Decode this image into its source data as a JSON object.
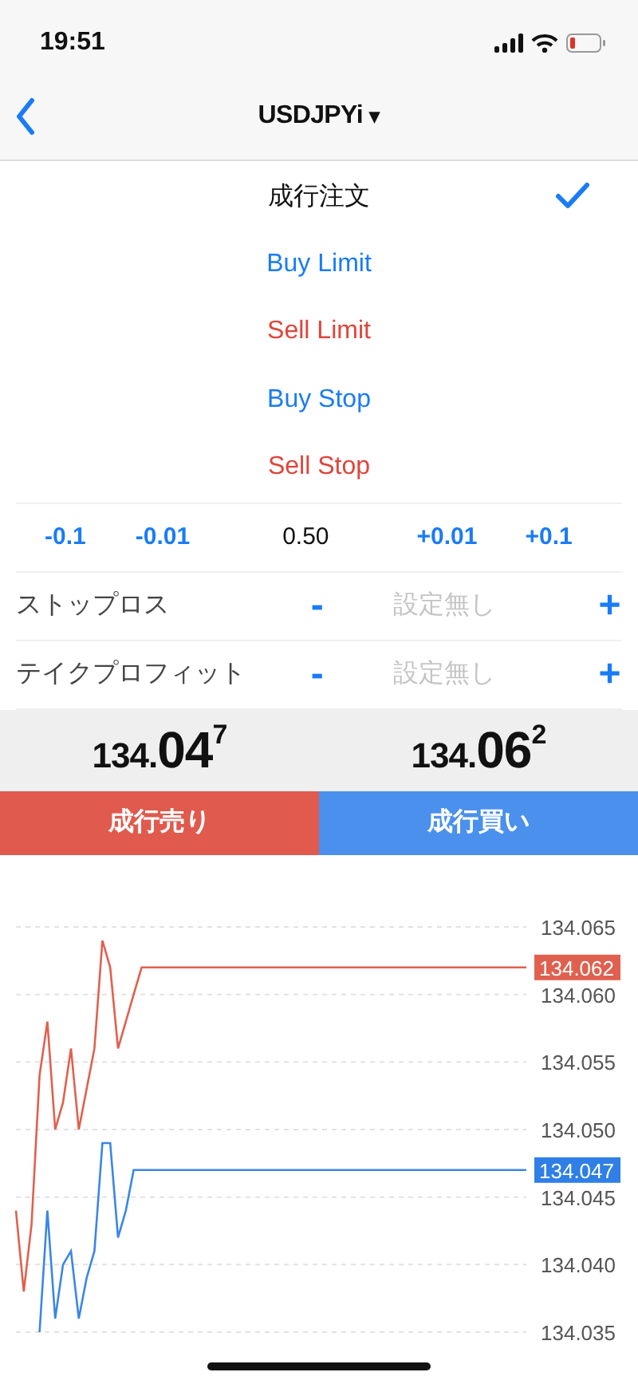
{
  "status_bar": {
    "time": "19:51"
  },
  "nav": {
    "title": "USDJPYi",
    "dropdown": "▾"
  },
  "order_types": [
    {
      "label": "成行注文",
      "kind": "market",
      "selected": true
    },
    {
      "label": "Buy Limit",
      "kind": "buy",
      "selected": false
    },
    {
      "label": "Sell Limit",
      "kind": "sell",
      "selected": false
    },
    {
      "label": "Buy Stop",
      "kind": "buy",
      "selected": false
    },
    {
      "label": "Sell Stop",
      "kind": "sell",
      "selected": false
    }
  ],
  "volume": {
    "steps_down": [
      "-0.1",
      "-0.01"
    ],
    "value": "0.50",
    "steps_up": [
      "+0.01",
      "+0.1"
    ]
  },
  "levels": [
    {
      "label": "ストップロス",
      "minus": "-",
      "placeholder": "設定無し",
      "plus": "+"
    },
    {
      "label": "テイクプロフィット",
      "minus": "-",
      "placeholder": "設定無し",
      "plus": "+"
    }
  ],
  "prices": [
    {
      "kind": "sell",
      "head": "134.",
      "big": "04",
      "tail": "7",
      "button": "成行売り"
    },
    {
      "kind": "buy",
      "head": "134.",
      "big": "06",
      "tail": "2",
      "button": "成行買い"
    }
  ],
  "chart": {
    "chart_data": {
      "type": "line",
      "categories": [
        null,
        null,
        null,
        null,
        null,
        null,
        null,
        null,
        null,
        null,
        null,
        null,
        null,
        null,
        null,
        null,
        null,
        null,
        null,
        null,
        null,
        null,
        null,
        null,
        null,
        null,
        null,
        null,
        null,
        null,
        null,
        null,
        null,
        null,
        null,
        null,
        null,
        null,
        null,
        null,
        null,
        null,
        null,
        null,
        null,
        null,
        null,
        null,
        null,
        null,
        null,
        null,
        null,
        null,
        null,
        null,
        null,
        null,
        null,
        null,
        null,
        null,
        null,
        null,
        null,
        null
      ],
      "series": [
        {
          "color": "#e0604f",
          "values": [
            134.044,
            134.038,
            134.043,
            134.054,
            134.058,
            134.05,
            134.052,
            134.056,
            134.05,
            134.053,
            134.056,
            134.064,
            134.062,
            134.056,
            134.058,
            134.06,
            134.062,
            134.062,
            134.062,
            134.062,
            134.062,
            134.062,
            134.062,
            134.062,
            134.062,
            134.062,
            134.062,
            134.062,
            134.062,
            134.062,
            134.062,
            134.062,
            134.062,
            134.062,
            134.062,
            134.062,
            134.062,
            134.062,
            134.062,
            134.062,
            134.062,
            134.062,
            134.062,
            134.062,
            134.062,
            134.062,
            134.062,
            134.062,
            134.062,
            134.062,
            134.062,
            134.062,
            134.062,
            134.062,
            134.062,
            134.062,
            134.062,
            134.062,
            134.062,
            134.062,
            134.062,
            134.062,
            134.062,
            134.062,
            134.062,
            134.062
          ]
        },
        {
          "color": "#3a86e8",
          "values": [
            null,
            null,
            null,
            134.035,
            134.044,
            134.036,
            134.04,
            134.041,
            134.036,
            134.039,
            134.041,
            134.049,
            134.049,
            134.042,
            134.044,
            134.047,
            134.047,
            134.047,
            134.047,
            134.047,
            134.047,
            134.047,
            134.047,
            134.047,
            134.047,
            134.047,
            134.047,
            134.047,
            134.047,
            134.047,
            134.047,
            134.047,
            134.047,
            134.047,
            134.047,
            134.047,
            134.047,
            134.047,
            134.047,
            134.047,
            134.047,
            134.047,
            134.047,
            134.047,
            134.047,
            134.047,
            134.047,
            134.047,
            134.047,
            134.047,
            134.047,
            134.047,
            134.047,
            134.047,
            134.047,
            134.047,
            134.047,
            134.047,
            134.047,
            134.047,
            134.047,
            134.047,
            134.047,
            134.047,
            134.047,
            134.047
          ]
        }
      ],
      "ylim": [
        134.035,
        134.065
      ],
      "grid": true,
      "yticks": [
        {
          "value": 134.065,
          "label": "134.065"
        },
        {
          "value": 134.06,
          "label": "134.060"
        },
        {
          "value": 134.055,
          "label": "134.055"
        },
        {
          "value": 134.05,
          "label": "134.050"
        },
        {
          "value": 134.045,
          "label": "134.045"
        },
        {
          "value": 134.04,
          "label": "134.040"
        },
        {
          "value": 134.035,
          "label": "134.035"
        }
      ]
    },
    "price_tags": [
      {
        "text": "134.062",
        "color": "#e0604f"
      },
      {
        "text": "134.047",
        "color": "#2f7fe6"
      }
    ]
  }
}
